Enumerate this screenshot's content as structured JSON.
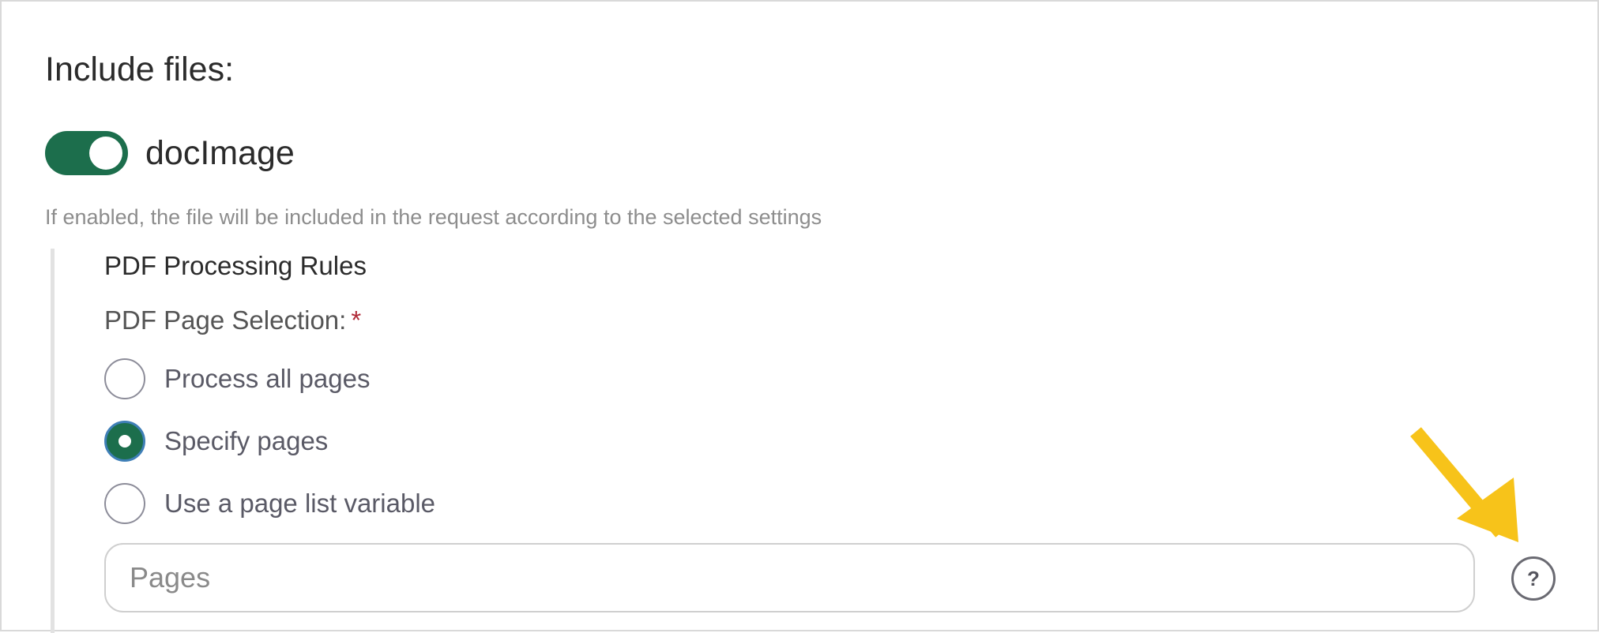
{
  "section": {
    "title": "Include files:"
  },
  "file_toggle": {
    "label": "docImage",
    "enabled": true,
    "helper_text": "If enabled, the file will be included in the request according to the selected settings"
  },
  "pdf_rules": {
    "title": "PDF Processing Rules",
    "page_selection_label": "PDF Page Selection:",
    "required_marker": "*",
    "options": [
      {
        "label": "Process all pages",
        "selected": false
      },
      {
        "label": "Specify pages",
        "selected": true
      },
      {
        "label": "Use a page list variable",
        "selected": false
      }
    ],
    "pages_input": {
      "value": "",
      "placeholder": "Pages"
    },
    "help_icon": "question-mark-icon",
    "help_glyph": "?"
  },
  "annotation": {
    "arrow_icon": "pointer-arrow-icon",
    "arrow_color": "#F7C31A"
  },
  "colors": {
    "accent": "#1C6E4C",
    "required": "#B02A37"
  }
}
